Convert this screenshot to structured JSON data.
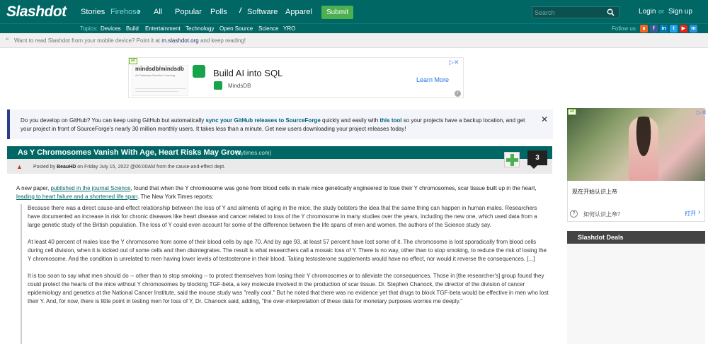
{
  "header": {
    "logo": "Slashdot",
    "nav": [
      "Stories",
      "Firehose",
      "All",
      "Popular",
      "Polls",
      "Software",
      "Apparel"
    ],
    "submit_label": "Submit",
    "search_placeholder": "Search",
    "login": "Login",
    "or": "or",
    "signup": "Sign up"
  },
  "subbar": {
    "topics_label": "Topics:",
    "topics": [
      "Devices",
      "Build",
      "Entertainment",
      "Technology",
      "Open Source",
      "Science",
      "YRO"
    ],
    "follow_label": "Follow us:",
    "social_icons": [
      "rss-icon",
      "facebook-icon",
      "linkedin-icon",
      "twitter-icon",
      "youtube-icon",
      "mastodon-icon"
    ]
  },
  "mobile_notice": {
    "prefix": "Want to read Slashdot from your mobile device? Point it at ",
    "link": "m.slashdot.org",
    "suffix": " and keep reading!"
  },
  "top_ad": {
    "badge": "ad",
    "thumb_title": "mindsdb/mindsdb",
    "thumb_sub": "An Database Machine Learning",
    "headline": "Build AI into SQL",
    "brand": "MindsDB",
    "cta": "Learn More"
  },
  "github_notice": {
    "t1": "Do you develop on GitHub? You can keep using GitHub but automatically ",
    "l1": "sync your GitHub releases to SourceForge",
    "t2": " quickly and easily with ",
    "l2": "this tool",
    "t3": " so your projects have a backup location, and get your project in front of SourceForge's nearly 30 million monthly users. It takes less than a minute. Get new users downloading your project releases today!"
  },
  "article": {
    "title": "As Y Chromosomes Vanish With Age, Heart Risks May Grow",
    "source": "(nytimes.com)",
    "posted_by_prefix": "Posted by ",
    "author": "BeauHD",
    "posted_suffix": " on Friday July 15, 2022 @06:00AM from the cause-and-effect dept.",
    "comment_count": "3",
    "intro_1": "A new paper, ",
    "intro_link1": "published in the journal Science",
    "intro_2": ", found that when the Y chromosome was gone from blood cells in male mice genetically engineered to lose their Y chromosomes, scar tissue built up in the heart, ",
    "intro_link2": "leading to heart failure and a shortened life span",
    "intro_3": ". The New York Times reports:",
    "quote": [
      "Because there was a direct cause-and-effect relationship between the loss of Y and ailments of aging in the mice, the study bolsters the idea that the same thing can happen in human males. Researchers have documented an increase in risk for chronic diseases like heart disease and cancer related to loss of the Y chromosome in many studies over the years, including the new one, which used data from a large genetic study of the British population. The loss of Y could even account for some of the difference between the life spans of men and women, the authors of the Science study say.",
      "At least 40 percent of males lose the Y chromosome from some of their blood cells by age 70. And by age 93, at least 57 percent have lost some of it. The chromosome is lost sporadically from blood cells during cell division, when it is kicked out of some cells and then disintegrates. The result is what researchers call a mosaic loss of Y. There is no way, other than to stop smoking, to reduce the risk of losing the Y chromosome. And the condition is unrelated to men having lower levels of testosterone in their blood. Taking testosterone supplements would have no effect, nor would it reverse the consequences. [...]",
      "It is too soon to say what men should do -- other than to stop smoking -- to protect themselves from losing their Y chromosomes or to alleviate the consequences. Those in [the researcher's] group found they could protect the hearts of the mice without Y chromosomes by blocking TGF-beta, a key molecule involved in the production of scar tissue. Dr. Stephen Chanock, the director of the division of cancer epidemiology and genetics at the National Cancer Institute, said the mouse study was \"really cool.\" But he noted that there was no evidence yet that drugs to block TGF-beta would be effective in men who lost their Y. And, for now, there is little point in testing men for loss of Y, Dr. Chanock said, adding, \"the over-interpretation of these data for monetary purposes worries me deeply.\""
    ]
  },
  "sidebar": {
    "ad_badge": "ad",
    "ad_caption": "现在开始认识上帝",
    "ad_question": "如何认识上帝？",
    "ad_open": "打开",
    "deals_title": "Slashdot Deals"
  }
}
